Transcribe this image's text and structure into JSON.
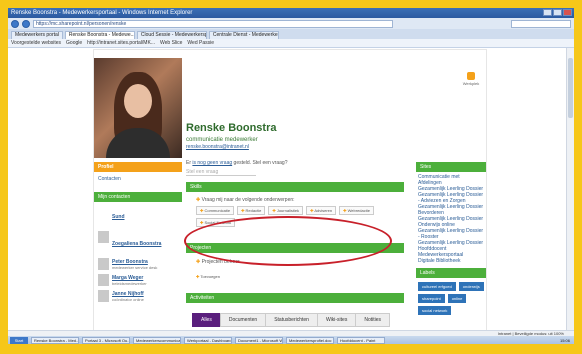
{
  "browser": {
    "title": "Renske Boonstra - Medewerkersportaal - Windows Internet Explorer",
    "url": "https://mc.sharepoint.nl/personen/renske",
    "tabs": [
      "Medewerkers portal",
      "Renske Boonstra - Medewe...",
      "Cloud Sessie - Medewerkersport...",
      "Centrale Dienst - Medewerkersl..."
    ],
    "favorites": [
      "Voorgestelde websites",
      "Google",
      "http://intranet.sites.portal/MK...",
      "Web Slice",
      "Wed Passie"
    ],
    "status": "Intranet | Beveiligde modus: uit  100%"
  },
  "profile": {
    "name": "Renske Boonstra",
    "role": "communicatie medewerker",
    "sublink": "renske.boonstra@intranet.nl",
    "question_prefix": "Er",
    "question_link": "is nog geen vraag",
    "question_suffix": "gesteld. Stel een vraag?",
    "question_placeholder": "Stel een vraag",
    "user_badge": "Werkplek"
  },
  "left_nav": {
    "header": "Profiel",
    "item": "Contacten",
    "contacts_header": "Mijn contacten",
    "contacts": [
      {
        "name": "Sund",
        "role": ""
      },
      {
        "name": "Zoegaliena Boonstra",
        "role": ""
      },
      {
        "name": "Peter Boonstra",
        "role": "medewerker service desk"
      },
      {
        "name": "Marga Weger",
        "role": "beleidsmedewerker"
      },
      {
        "name": "Janne Nijhoff",
        "role": "coördinator online"
      }
    ]
  },
  "sections": {
    "skills_header": "Skills",
    "skills_question": "Vraag mij naar de volgende onderwerpen:",
    "skills": [
      "Communicatie",
      "Redactie",
      "Journalistiek",
      "Adviseren",
      "Webredactie",
      "Social Network"
    ],
    "projects_header": "Projecten",
    "projects_item": "Projecten beheer",
    "projects_tag": "Toevoegen",
    "activities_header": "Activiteiten",
    "activity_tabs": [
      "Alles",
      "Documenten",
      "Statusberichten",
      "Wiki-sites",
      "Notities"
    ]
  },
  "right": {
    "sites_header": "Sites",
    "sites": [
      "Communicatie met Afdelingen",
      "Gezamenlijk Leerling Dossier",
      "Gezamenlijk Leerling Dossier - Adviezen en Zorgen",
      "Gezamenlijk Leerling Dossier",
      "Bevorderen",
      "Gezamenlijk Leerling Dossier",
      "Onderwijs online",
      "Gezamenlijk Leerling Dossier - Rooster",
      "Gezamenlijk Leerling Dossier",
      "Hoofddocent",
      "Medewerkersportaal",
      "Digitale Bibliotheek"
    ],
    "labels_header": "Labels",
    "labels": [
      "cultureel erfgoed",
      "onderwijs",
      "sharepoint",
      "online",
      "social network"
    ]
  },
  "taskbar": {
    "start": "Start",
    "items": [
      "Renske Boonstra - Med...",
      "Portaal 3 - Microsoft Ou...",
      "Medewerkerscommunicat...",
      "Werkportaal - Dashboard...",
      "Document1 - Microsoft W...",
      "Medewerkersprofiel.doc",
      "Hoofddocent - Paint"
    ],
    "clock": "15:06"
  }
}
